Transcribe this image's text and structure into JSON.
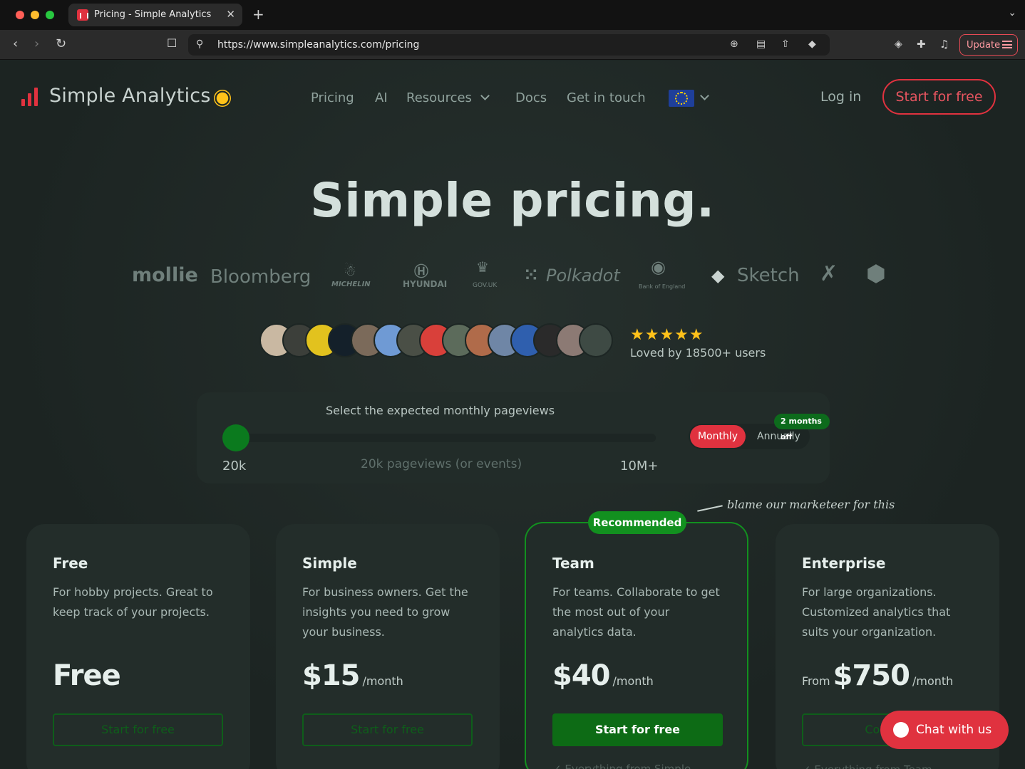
{
  "browser": {
    "tab_title": "Pricing - Simple Analytics",
    "url": "https://www.simpleanalytics.com/pricing",
    "update_label": "Update"
  },
  "site": {
    "logo_text": "Simple Analytics",
    "nav": {
      "pricing": "Pricing",
      "ai": "AI",
      "resources": "Resources",
      "docs": "Docs",
      "contact": "Get in touch"
    },
    "login": "Log in",
    "cta": "Start for free"
  },
  "hero": {
    "title": "Simple pricing."
  },
  "brands": {
    "mollie": "mollie",
    "bloomberg": "Bloomberg",
    "michelin": "MICHELIN",
    "hyundai": "HYUNDAI",
    "govuk": "GOV.UK",
    "polkadot": "Polkadot",
    "boe": "Bank of England",
    "sketch": "Sketch"
  },
  "social": {
    "stars": "★★★★★",
    "loved": "Loved by 18500+ users"
  },
  "slider": {
    "label": "Select the expected monthly pageviews",
    "min": "20k",
    "value": "20k pageviews (or events)",
    "max": "10M+",
    "position": 0,
    "monthly": "Monthly",
    "annually": "Annually",
    "discount": "2 months off"
  },
  "note": "blame our marketeer for this",
  "plans": [
    {
      "name": "Free",
      "desc": "For hobby projects. Great to keep track of your projects.",
      "from": "",
      "price": "Free",
      "per": "",
      "button": "Start for free",
      "foot": ""
    },
    {
      "name": "Simple",
      "desc": "For business owners. Get the insights you need to grow your business.",
      "from": "",
      "price": "$15",
      "per": "/month",
      "button": "Start for free",
      "foot": ""
    },
    {
      "name": "Team",
      "badge": "Recommended",
      "desc": "For teams. Collaborate to get the most out of your analytics data.",
      "from": "",
      "price": "$40",
      "per": "/month",
      "button": "Start for free",
      "foot": "Everything from Simple"
    },
    {
      "name": "Enterprise",
      "desc": "For large organizations. Customized analytics that suits your organization.",
      "from": "From",
      "price": "$750",
      "per": "/month",
      "button": "Contact",
      "foot": "Everything from Team"
    }
  ],
  "chat": {
    "label": "Chat with us"
  }
}
